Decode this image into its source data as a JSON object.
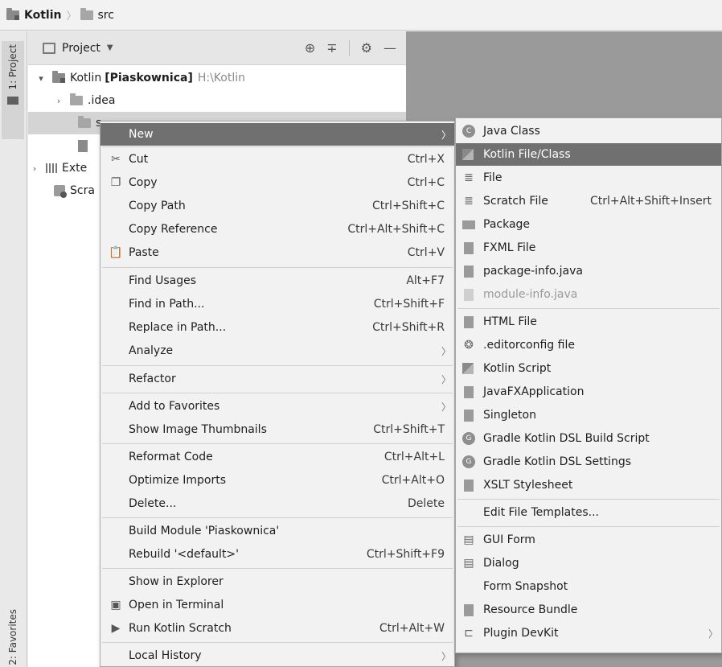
{
  "navbar": {
    "project": "Kotlin",
    "folder": "src"
  },
  "sidebar": {
    "project_tab": "1: Project",
    "favorites_tab": "2: Favorites"
  },
  "project_panel": {
    "title": "Project",
    "root_name": "Kotlin",
    "root_module": "[Piaskownica]",
    "root_path": "H:\\Kotlin",
    "idea": ".idea",
    "src_partial": "s",
    "ext_partial": "Exte",
    "scratch_partial": "Scra"
  },
  "context_menu": {
    "items": [
      {
        "label": "New",
        "shortcut": "",
        "submenu": true
      },
      {
        "label": "Cut",
        "shortcut": "Ctrl+X"
      },
      {
        "label": "Copy",
        "shortcut": "Ctrl+C"
      },
      {
        "label": "Copy Path",
        "shortcut": "Ctrl+Shift+C"
      },
      {
        "label": "Copy Reference",
        "shortcut": "Ctrl+Alt+Shift+C"
      },
      {
        "label": "Paste",
        "shortcut": "Ctrl+V"
      },
      {
        "label": "Find Usages",
        "shortcut": "Alt+F7"
      },
      {
        "label": "Find in Path...",
        "shortcut": "Ctrl+Shift+F"
      },
      {
        "label": "Replace in Path...",
        "shortcut": "Ctrl+Shift+R"
      },
      {
        "label": "Analyze",
        "shortcut": "",
        "submenu": true
      },
      {
        "label": "Refactor",
        "shortcut": "",
        "submenu": true
      },
      {
        "label": "Add to Favorites",
        "shortcut": "",
        "submenu": true
      },
      {
        "label": "Show Image Thumbnails",
        "shortcut": "Ctrl+Shift+T"
      },
      {
        "label": "Reformat Code",
        "shortcut": "Ctrl+Alt+L"
      },
      {
        "label": "Optimize Imports",
        "shortcut": "Ctrl+Alt+O"
      },
      {
        "label": "Delete...",
        "shortcut": "Delete"
      },
      {
        "label": "Build Module 'Piaskownica'",
        "shortcut": ""
      },
      {
        "label": "Rebuild '<default>'",
        "shortcut": "Ctrl+Shift+F9"
      },
      {
        "label": "Show in Explorer",
        "shortcut": ""
      },
      {
        "label": "Open in Terminal",
        "shortcut": ""
      },
      {
        "label": "Run Kotlin Scratch",
        "shortcut": "Ctrl+Alt+W"
      },
      {
        "label": "Local History",
        "shortcut": "",
        "submenu": true
      }
    ]
  },
  "new_submenu": {
    "items": [
      {
        "label": "Java Class",
        "shortcut": ""
      },
      {
        "label": "Kotlin File/Class",
        "shortcut": ""
      },
      {
        "label": "File",
        "shortcut": ""
      },
      {
        "label": "Scratch File",
        "shortcut": "Ctrl+Alt+Shift+Insert"
      },
      {
        "label": "Package",
        "shortcut": ""
      },
      {
        "label": "FXML File",
        "shortcut": ""
      },
      {
        "label": "package-info.java",
        "shortcut": ""
      },
      {
        "label": "module-info.java",
        "shortcut": ""
      },
      {
        "label": "HTML File",
        "shortcut": ""
      },
      {
        "label": ".editorconfig file",
        "shortcut": ""
      },
      {
        "label": "Kotlin Script",
        "shortcut": ""
      },
      {
        "label": "JavaFXApplication",
        "shortcut": ""
      },
      {
        "label": "Singleton",
        "shortcut": ""
      },
      {
        "label": "Gradle Kotlin DSL Build Script",
        "shortcut": ""
      },
      {
        "label": "Gradle Kotlin DSL Settings",
        "shortcut": ""
      },
      {
        "label": "XSLT Stylesheet",
        "shortcut": ""
      },
      {
        "label": "Edit File Templates...",
        "shortcut": ""
      },
      {
        "label": "GUI Form",
        "shortcut": ""
      },
      {
        "label": "Dialog",
        "shortcut": ""
      },
      {
        "label": "Form Snapshot",
        "shortcut": ""
      },
      {
        "label": "Resource Bundle",
        "shortcut": ""
      },
      {
        "label": "Plugin DevKit",
        "shortcut": "",
        "submenu": true
      }
    ]
  },
  "colors": {
    "highlight": "#707070",
    "menu_bg": "#f2f2f2",
    "editor_bg": "#9a9a9a"
  }
}
